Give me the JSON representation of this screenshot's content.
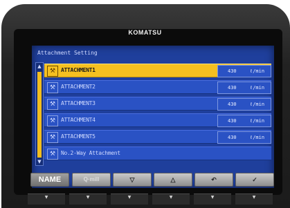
{
  "brand": {
    "name": "KOMATSU",
    "tagline": ""
  },
  "screen": {
    "title": "Attachment Setting",
    "rows": [
      {
        "name": "ATTACHMENT1",
        "value": "430",
        "unit": "ℓ/min",
        "selected": true
      },
      {
        "name": "ATTACHMENT2",
        "value": "430",
        "unit": "ℓ/min",
        "selected": false
      },
      {
        "name": "ATTACHMENT3",
        "value": "430",
        "unit": "ℓ/min",
        "selected": false
      },
      {
        "name": "ATTACHMENT4",
        "value": "430",
        "unit": "ℓ/min",
        "selected": false
      },
      {
        "name": "ATTACHMENT5",
        "value": "430",
        "unit": "ℓ/min",
        "selected": false
      },
      {
        "name": "No.2-Way Attachment",
        "value": "",
        "unit": "",
        "selected": false
      }
    ],
    "function_keys": [
      {
        "label": "NAME",
        "icon": "name-text"
      },
      {
        "label": "Q·mill",
        "icon": "flow-text"
      },
      {
        "label": "▽",
        "icon": "down-arrow-icon"
      },
      {
        "label": "△",
        "icon": "up-arrow-icon"
      },
      {
        "label": "↶",
        "icon": "return-icon"
      },
      {
        "label": "✓",
        "icon": "check-icon"
      }
    ],
    "scroll": {
      "up": "▲",
      "down": "▼"
    }
  },
  "hardware_buttons": [
    "▼",
    "▼",
    "▼",
    "▼",
    "▼",
    "▼"
  ],
  "colors": {
    "screen_bg": "#1f3f9c",
    "selected_row": "#f5c020",
    "row_bg": "#2a52c4"
  }
}
